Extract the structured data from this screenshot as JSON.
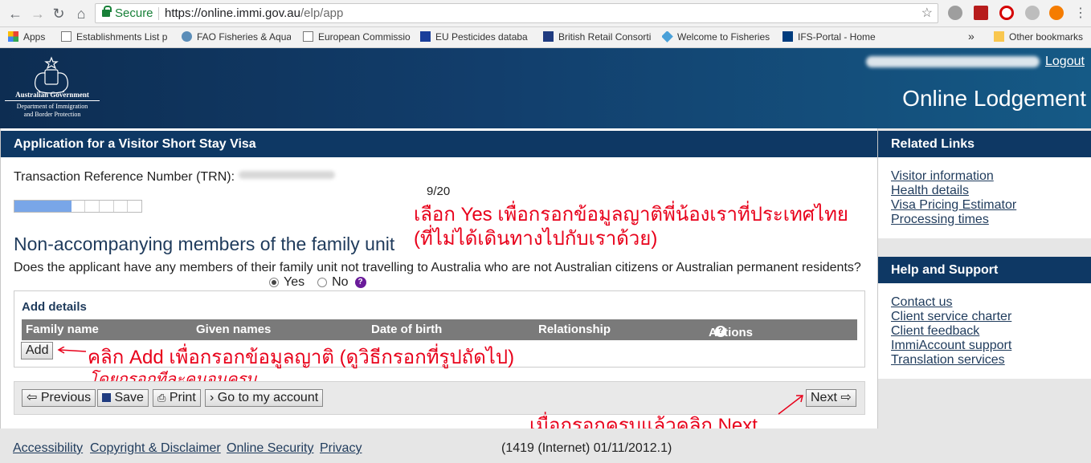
{
  "browser": {
    "secure_label": "Secure",
    "url_host": "https://online.immi.gov.au",
    "url_path": "/elp/app",
    "bookmarks": [
      {
        "label": "Apps"
      },
      {
        "label": "Establishments List p"
      },
      {
        "label": "FAO Fisheries & Aqua"
      },
      {
        "label": "European Commissio"
      },
      {
        "label": "EU Pesticides databa"
      },
      {
        "label": "British Retail Consorti"
      },
      {
        "label": "Welcome to Fisheries"
      },
      {
        "label": "IFS-Portal - Home"
      }
    ],
    "overflow_label": "»",
    "other_bookmarks": "Other bookmarks"
  },
  "header": {
    "gov_line1": "Australian Government",
    "gov_line2": "Department of Immigration",
    "gov_line3": "and Border Protection",
    "logout": "Logout",
    "app_title": "Online Lodgement"
  },
  "main": {
    "heading": "Application for a Visitor Short Stay Visa",
    "trn_label": "Transaction Reference Number (TRN):",
    "progress": {
      "label": "9/20",
      "segments_total": 9,
      "segments_done": 4
    },
    "page_title": "Non-accompanying members of the family unit",
    "question": "Does the applicant have any members of their family unit not travelling to Australia who are not Australian citizens or Australian permanent residents?",
    "yes_label": "Yes",
    "no_label": "No",
    "help_glyph": "?",
    "add_details": {
      "title": "Add details",
      "columns": [
        "Family name",
        "Given names",
        "Date of birth",
        "Relationship",
        "Actions"
      ],
      "add_button": "Add"
    },
    "nav": {
      "previous": "Previous",
      "save": "Save",
      "print": "Print",
      "go_to_account": "Go to my account",
      "next": "Next"
    },
    "annotations": {
      "yes_note_line1": "เลือก Yes เพื่อกรอกข้อมูลญาติพี่น้องเราที่ประเทศไทย",
      "yes_note_line2": "(ที่ไม่ได้เดินทางไปกับเราด้วย)",
      "add_note": "คลิก Add เพื่อกรอกข้อมูลญาติ (ดูวิธีกรอกที่รูปถัดไป)",
      "add_note2": "โดยกรอกทีละคนจนครบ",
      "next_note": "เมื่อกรอกครบแล้วคลิก Next"
    }
  },
  "sidebar": {
    "related_title": "Related Links",
    "related_links": [
      "Visitor information",
      "Health details",
      "Visa Pricing Estimator",
      "Processing times"
    ],
    "help_title": "Help and Support",
    "help_links": [
      "Contact us",
      "Client service charter",
      "Client feedback",
      "ImmiAccount support",
      "Translation services"
    ]
  },
  "footer": {
    "links": [
      "Accessibility",
      "Copyright & Disclaimer",
      "Online Security",
      "Privacy"
    ],
    "version": "(1419 (Internet) 01/11/2012.1)"
  },
  "colors": {
    "brand_navy": "#0e3864",
    "annotation_red": "#e8001a",
    "progress_fill": "#79a6e8"
  }
}
